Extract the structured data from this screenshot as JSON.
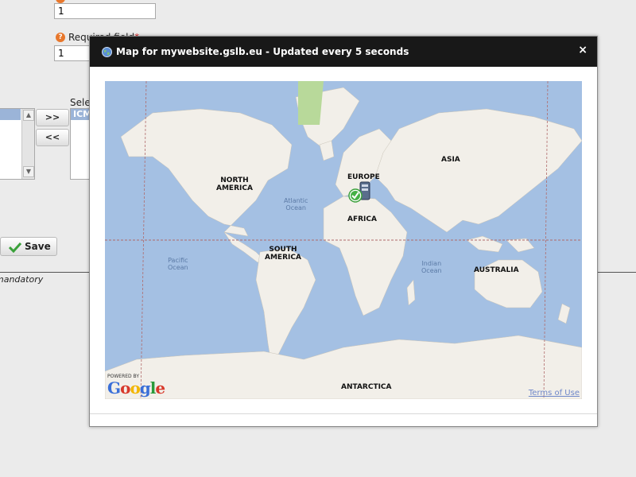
{
  "form": {
    "field1_value": "1",
    "field2_label": "Required field",
    "field2_value": "1",
    "select_label": "Selected",
    "selected_option": "ICMP",
    "move_right_label": ">>",
    "move_left_label": "<<",
    "save_label": "Save",
    "mandatory_note": "mandatory"
  },
  "dialog": {
    "title": "Map for mywebsite.gslb.eu - Updated every 5 seconds",
    "close_label": "×",
    "icon": "globe-icon"
  },
  "map": {
    "continents": {
      "north_america": "NORTH\nAMERICA",
      "south_america": "SOUTH\nAMERICA",
      "europe": "EUROPE",
      "africa": "AFRICA",
      "asia": "ASIA",
      "australia": "AUSTRALIA",
      "antarctica": "ANTARCTICA"
    },
    "oceans": {
      "atlantic": "Atlantic\nOcean",
      "pacific": "Pacific\nOcean",
      "indian": "Indian\nOcean"
    },
    "powered_by": "POWERED BY",
    "logo_text": "Google",
    "terms_label": "Terms of Use",
    "marker_status": "ok",
    "colors": {
      "water": "#a4c0e3",
      "land": "#f2efe9",
      "green": "#b8d99a"
    }
  }
}
